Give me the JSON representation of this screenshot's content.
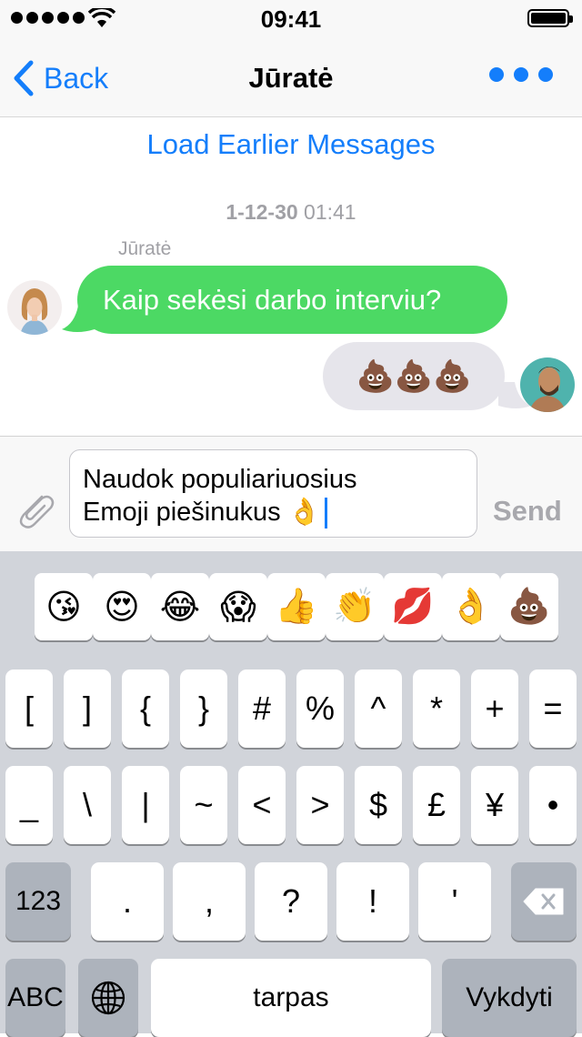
{
  "status_bar": {
    "time": "09:41"
  },
  "nav": {
    "back_label": "Back",
    "title": "Jūratė"
  },
  "chat": {
    "load_earlier": "Load Earlier Messages",
    "timestamp_date": "1-12-30",
    "timestamp_time": "01:41",
    "messages": [
      {
        "sender": "Jūratė",
        "text": "Kaip sekėsi darbo interviu?"
      },
      {
        "sender": "me",
        "text": "💩💩💩"
      }
    ]
  },
  "input": {
    "line1": "Naudok populiariuosius",
    "line2": "Emoji piešinukus 👌",
    "send_label": "Send"
  },
  "keyboard": {
    "emoji_bar": [
      "😘",
      "😍",
      "😂",
      "😱",
      "👍",
      "👏",
      "💋",
      "👌",
      "💩"
    ],
    "row1": [
      "[",
      "]",
      "{",
      "}",
      "#",
      "%",
      "^",
      "*",
      "+",
      "="
    ],
    "row2": [
      "_",
      "\\",
      "|",
      "~",
      "<",
      ">",
      "$",
      "£",
      "¥",
      "•"
    ],
    "row3": {
      "mode": "123",
      "keys": [
        ".",
        ",",
        "?",
        "!",
        "'"
      ]
    },
    "row4": {
      "abc": "ABC",
      "space": "tarpas",
      "return": "Vykdyti"
    }
  },
  "colors": {
    "accent": "#147efb",
    "incoming_bubble": "#4cd964",
    "outgoing_bubble": "#e6e5eb",
    "keyboard_bg": "#d1d4da"
  },
  "icons": [
    "back-chevron-icon",
    "more-dots-icon",
    "paperclip-icon",
    "globe-icon",
    "delete-icon",
    "wifi-icon",
    "battery-icon"
  ]
}
